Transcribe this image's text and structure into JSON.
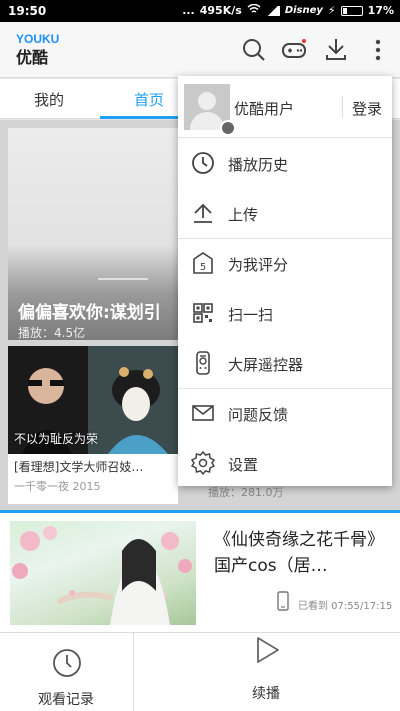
{
  "status_bar": {
    "time": "19:50",
    "dots": "...",
    "speed": "495K/s",
    "carrier": "Disney",
    "battery": "17%"
  },
  "header": {
    "logo_en_a": "YOU",
    "logo_en_b": "KU",
    "logo_cn": "优酷",
    "icons": [
      "search-icon",
      "game-controller-icon",
      "download-icon",
      "more-vertical-icon"
    ],
    "accent": "#1ea1f2"
  },
  "tabs": [
    {
      "label": "我的"
    },
    {
      "label": "首页"
    }
  ],
  "feed": {
    "hero": {
      "title": "偏偏喜欢你:谋划引",
      "subtitle": "播放：4.5亿"
    },
    "card": {
      "caption": "不以为耻反为荣",
      "title": "[看理想]文学大师召妓…",
      "subtitle": "一千零一夜 2015"
    },
    "card2_subtitle": "播放：281.0万"
  },
  "menu": {
    "user_name": "优酷用户",
    "login_label": "登录",
    "items": [
      {
        "label": "播放历史",
        "icon": "clock-icon"
      },
      {
        "label": "上传",
        "icon": "upload-icon"
      },
      {
        "label": "为我评分",
        "icon": "rate-icon",
        "badge": "5"
      },
      {
        "label": "扫一扫",
        "icon": "qr-code-icon"
      },
      {
        "label": "大屏遥控器",
        "icon": "remote-control-icon"
      },
      {
        "label": "问题反馈",
        "icon": "mail-icon"
      },
      {
        "label": "设置",
        "icon": "gear-icon"
      }
    ]
  },
  "promo": {
    "title": "《仙侠奇缘之花千骨》国产cos（居…",
    "watched": "已看到 07:55/17:15"
  },
  "bottom_bar": {
    "history_label": "观看记录",
    "continue_label": "续播"
  }
}
